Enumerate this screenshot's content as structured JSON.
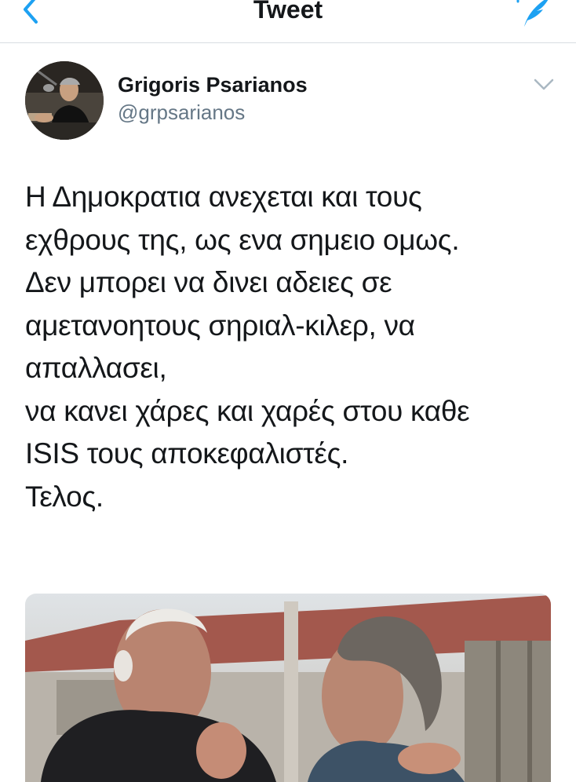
{
  "header": {
    "title": "Tweet",
    "back_icon": "chevron-left-icon",
    "compose_icon": "compose-tweet-icon",
    "accent_color": "#1da1f2"
  },
  "tweet": {
    "author": {
      "name": "Grigoris Psarianos",
      "handle": "@grpsarianos"
    },
    "text": "Η Δημοκρατια ανεχεται και τους\nεχθρους της, ως ενα σημειο ομως.\nΔεν μπορει να δινει αδειες σε\nαμετανοητους σηριαλ-κιλερ,  να\nαπαλλασει,\nνα κανει χάρες και χαρές στου καθε\nISIS τους αποκεφαλιστές.\nΤελος.",
    "menu_icon": "chevron-down-icon"
  },
  "colors": {
    "text": "#14171a",
    "secondary_text": "#657786",
    "divider": "#d8dde2"
  }
}
